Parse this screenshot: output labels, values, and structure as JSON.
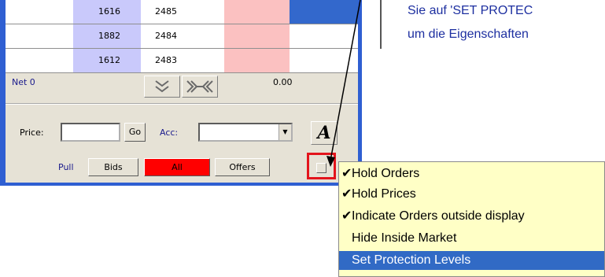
{
  "ladder": {
    "rows": [
      {
        "bid": "1616",
        "price": "2485",
        "selected": true
      },
      {
        "bid": "1882",
        "price": "2484",
        "selected": false
      },
      {
        "bid": "1612",
        "price": "2483",
        "selected": false
      }
    ]
  },
  "panel": {
    "net_label": "Net 0",
    "net_value": "0.00",
    "arrow_collapse_icon": "double-chevron-down",
    "arrow_center_icon": "center-arrows",
    "price_label": "Price:",
    "go_label": "Go",
    "acc_label": "Acc:",
    "font_glyph": "A",
    "pull_label": "Pull",
    "bids_label": "Bids",
    "all_label": "All",
    "offers_label": "Offers"
  },
  "menu": {
    "items": [
      {
        "label": "Hold Orders",
        "checked": true,
        "highlighted": false
      },
      {
        "label": "Hold Prices",
        "checked": true,
        "highlighted": false
      },
      {
        "label": "Indicate Orders outside display",
        "checked": true,
        "highlighted": false
      },
      {
        "label": "Hide Inside Market",
        "checked": false,
        "highlighted": false
      },
      {
        "label": "Set Protection Levels",
        "checked": false,
        "highlighted": true
      }
    ]
  },
  "help_text": {
    "line1": "Sie auf 'SET PROTEC",
    "line2": "um die Eigenschaften"
  },
  "colors": {
    "window_border": "#2f5fd2",
    "bid_column": "#c9c9fb",
    "ask_column": "#fbc1c1",
    "selected_cell": "#3368cc",
    "all_button": "#ff0000",
    "menu_background": "#ffffc6",
    "menu_highlight": "#316ac5",
    "callout_box": "#e3141c",
    "help_text": "#1d2fa0"
  }
}
